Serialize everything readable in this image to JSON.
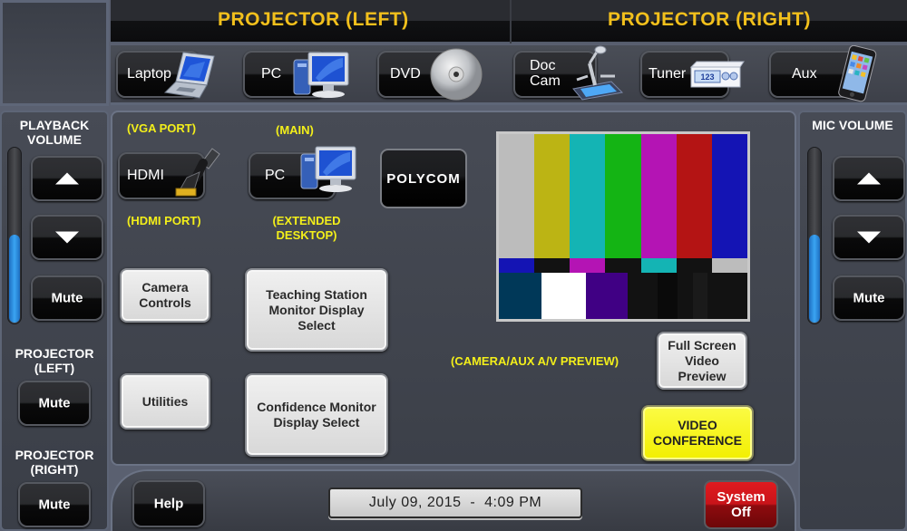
{
  "header": {
    "left_title": "PROJECTOR (LEFT)",
    "right_title": "PROJECTOR (RIGHT)"
  },
  "sources": [
    {
      "label": "Laptop",
      "icon": "laptop-icon"
    },
    {
      "label": "PC",
      "icon": "desktop-pc-icon"
    },
    {
      "label": "DVD",
      "icon": "disc-icon"
    },
    {
      "label": "Doc Cam",
      "icon": "document-camera-icon"
    },
    {
      "label": "Tuner",
      "icon": "tuner-icon",
      "tuner_display": "123"
    },
    {
      "label": "Aux",
      "icon": "media-player-icon"
    }
  ],
  "left_panel": {
    "playback_title": "PLAYBACK VOLUME",
    "playback_level_percent": 50,
    "mute_label": "Mute",
    "projector_left_title": "PROJECTOR (LEFT)",
    "projector_left_mute": "Mute",
    "projector_right_title": "PROJECTOR (RIGHT)",
    "projector_right_mute": "Mute"
  },
  "right_panel": {
    "mic_title": "MIC VOLUME",
    "mic_level_percent": 50,
    "mute_label": "Mute"
  },
  "main": {
    "vga_port_label": "(VGA PORT)",
    "hdmi_button": "HDMI",
    "hdmi_port_label": "(HDMI PORT)",
    "main_label": "(MAIN)",
    "pc_button": "PC",
    "extended_label_1": "(EXTENDED",
    "extended_label_2": "DESKTOP)",
    "polycom_button": "POLYCOM",
    "camera_controls_1": "Camera",
    "camera_controls_2": "Controls",
    "teaching_station_1": "Teaching Station",
    "teaching_station_2": "Monitor Display",
    "teaching_station_3": "Select",
    "utilities": "Utilities",
    "confidence_1": "Confidence Monitor",
    "confidence_2": "Display Select",
    "preview_label": "(CAMERA/AUX A/V PREVIEW)",
    "full_screen_1": "Full Screen",
    "full_screen_2": "Video",
    "full_screen_3": "Preview",
    "video_conf_1": "VIDEO",
    "video_conf_2": "CONFERENCE",
    "test_pattern": {
      "top_bars": [
        "#bcbcbc",
        "#bcb414",
        "#14b4b4",
        "#14b414",
        "#b414b4",
        "#b41414",
        "#1414b4"
      ],
      "mid_bars": [
        "#1414b4",
        "#121212",
        "#b414b4",
        "#121212",
        "#14b4b4",
        "#121212",
        "#bcbcbc"
      ],
      "bottom_bars": [
        "#003858",
        "#ffffff",
        "#400084",
        "#121212",
        "#0a0a0a",
        "#121212",
        "#1a1a1a",
        "#121212"
      ]
    }
  },
  "footer": {
    "help_button": "Help",
    "datetime": "July 09, 2015  -  4:09 PM",
    "system_off_1": "System",
    "system_off_2": "Off"
  }
}
